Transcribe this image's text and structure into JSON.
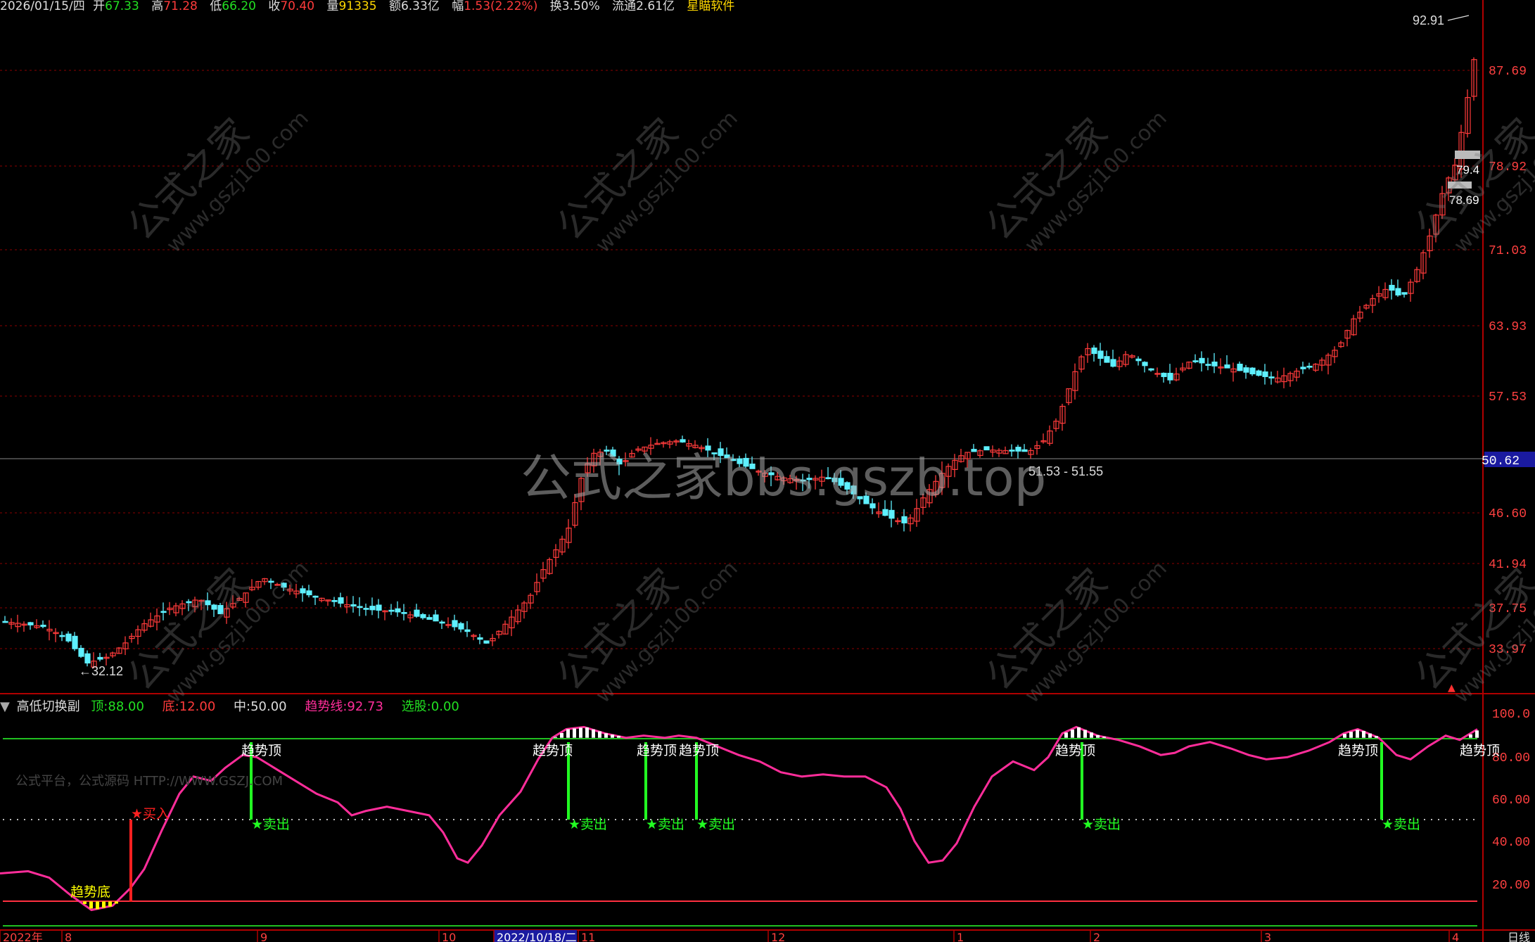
{
  "info_bar": {
    "date": "2026/01/15/四",
    "open_label": "开",
    "open": "67.33",
    "high_label": "高",
    "high": "71.28",
    "low_label": "低",
    "low": "66.20",
    "close_label": "收",
    "close": "70.40",
    "volume_label": "量",
    "volume": "91335",
    "amount_label": "额",
    "amount": "6.33亿",
    "change_label": "幅",
    "change": "1.53(2.22%)",
    "turnover_label": "换",
    "turnover": "3.50%",
    "float_label": "流通",
    "float": "2.61亿",
    "software": "星瞄软件"
  },
  "price_axis": {
    "ticks": [
      "87.69",
      "78.92",
      "71.03",
      "63.93",
      "57.53",
      "46.60",
      "41.94",
      "37.75",
      "33.97"
    ],
    "current": "50.62",
    "colors": {
      "up": "#ff3b3b",
      "down": "#5ef0ff",
      "grid": "#8b0000",
      "current_bg": "#1a1aa0"
    }
  },
  "price_annotations": {
    "high_marker": "92.91",
    "low_marker": "32.12",
    "range_label": "51.53 - 51.55",
    "box_label_1": "79.4",
    "box_label_2": "78.69"
  },
  "watermarks": {
    "center": "公式之家bbs.gszb.top",
    "diagonal_cn": "公式之家",
    "diagonal_url": "www.gszj100.com",
    "indicator_note": "公式平台，公式源码 HTTP://WWW.GSZJ.COM"
  },
  "indicator": {
    "name": "高低切换副",
    "top_label": "顶:",
    "top": "88.00",
    "bottom_label": "底:",
    "bottom": "12.00",
    "mid_label": "中:",
    "mid": "50.00",
    "trend_label": "趋势线:",
    "trend": "92.73",
    "pick_label": "选股:",
    "pick": "0.00",
    "axis_ticks": [
      "100.0",
      "80.00",
      "60.00",
      "40.00",
      "20.00"
    ],
    "signal_top": "趋势顶",
    "signal_bottom": "趋势底",
    "buy": "★买入",
    "sell": "★卖出",
    "colors": {
      "line": "#ff2d9a",
      "top": "#20c020",
      "bottom": "#ff3040",
      "mid": "#bbbbbb",
      "sell": "#22ff22",
      "buy": "#ff2020",
      "bottom_fill": "#ffff00"
    }
  },
  "time_axis": {
    "labels": [
      "2022年",
      "8",
      "9",
      "10",
      "2022/10/18/二",
      "11",
      "12",
      "1",
      "2",
      "3",
      "4"
    ],
    "period": "日线"
  }
}
